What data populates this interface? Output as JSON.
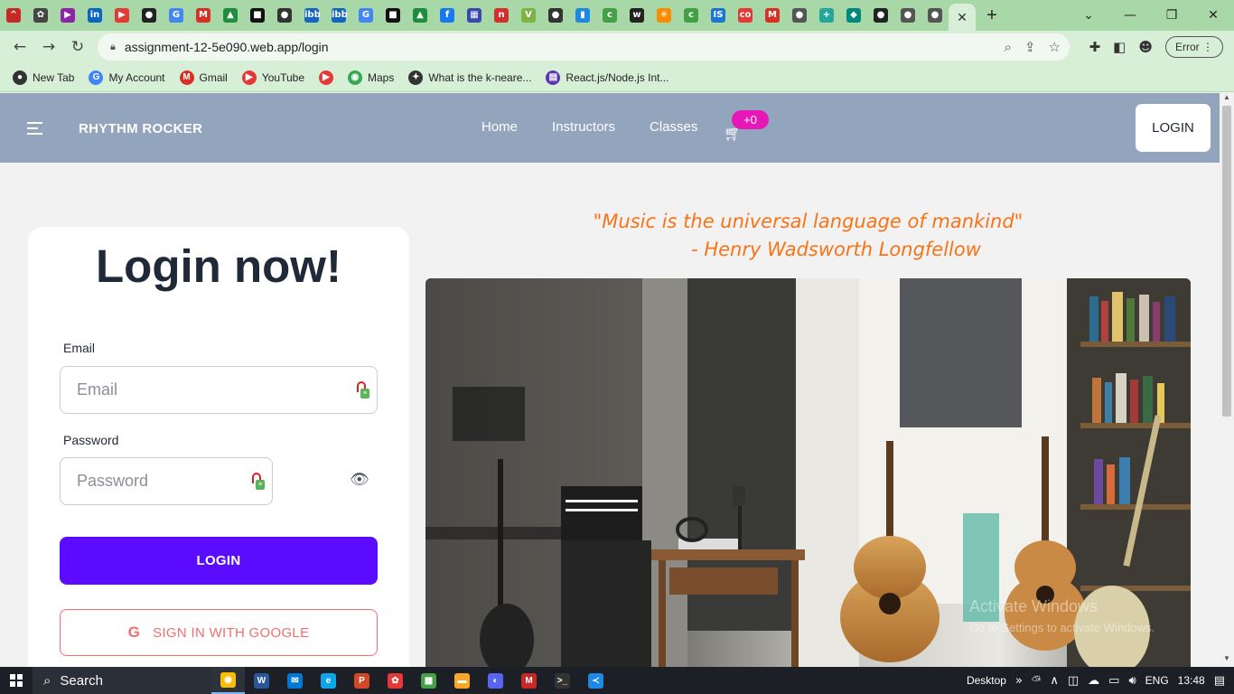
{
  "browser": {
    "tab_favicons": [
      {
        "name": "tab-favicon-1",
        "color": "#c62828",
        "glyph": "^"
      },
      {
        "name": "tab-favicon-chatgpt",
        "color": "#444444",
        "glyph": "✿"
      },
      {
        "name": "tab-favicon-3",
        "color": "#8e24aa",
        "glyph": "▶"
      },
      {
        "name": "tab-favicon-linkedin",
        "color": "#0a66c2",
        "glyph": "in"
      },
      {
        "name": "tab-favicon-youtube",
        "color": "#e53935",
        "glyph": "▶"
      },
      {
        "name": "tab-favicon-github",
        "color": "#222222",
        "glyph": "●"
      },
      {
        "name": "tab-favicon-google",
        "color": "#4285f4",
        "glyph": "G"
      },
      {
        "name": "tab-favicon-gmail",
        "color": "#d93025",
        "glyph": "M"
      },
      {
        "name": "tab-favicon-drive",
        "color": "#1e8e3e",
        "glyph": "▲"
      },
      {
        "name": "tab-favicon-10",
        "color": "#111111",
        "glyph": "■"
      },
      {
        "name": "tab-favicon-11",
        "color": "#333333",
        "glyph": "●"
      },
      {
        "name": "tab-favicon-imgbb-1",
        "color": "#1565c0",
        "glyph": "ibb"
      },
      {
        "name": "tab-favicon-imgbb-2",
        "color": "#1565c0",
        "glyph": "ibb"
      },
      {
        "name": "tab-favicon-google-2",
        "color": "#4285f4",
        "glyph": "G"
      },
      {
        "name": "tab-favicon-15",
        "color": "#111111",
        "glyph": "■"
      },
      {
        "name": "tab-favicon-drive-2",
        "color": "#1e8e3e",
        "glyph": "▲"
      },
      {
        "name": "tab-favicon-facebook",
        "color": "#1877f2",
        "glyph": "f"
      },
      {
        "name": "tab-favicon-18",
        "color": "#3949ab",
        "glyph": "▦"
      },
      {
        "name": "tab-favicon-19",
        "color": "#d32f2f",
        "glyph": "n"
      },
      {
        "name": "tab-favicon-20",
        "color": "#7cb342",
        "glyph": "V"
      },
      {
        "name": "tab-favicon-21",
        "color": "#333333",
        "glyph": "●"
      },
      {
        "name": "tab-favicon-22",
        "color": "#1e88e5",
        "glyph": "▮"
      },
      {
        "name": "tab-favicon-23",
        "color": "#43a047",
        "glyph": "c"
      },
      {
        "name": "tab-favicon-w3",
        "color": "#222222",
        "glyph": "w"
      },
      {
        "name": "tab-favicon-25",
        "color": "#fb8c00",
        "glyph": "✳"
      },
      {
        "name": "tab-favicon-26",
        "color": "#43a047",
        "glyph": "c"
      },
      {
        "name": "tab-favicon-27",
        "color": "#1976d2",
        "glyph": "IS"
      },
      {
        "name": "tab-favicon-28",
        "color": "#e53935",
        "glyph": "co"
      },
      {
        "name": "tab-favicon-gmail-2",
        "color": "#d93025",
        "glyph": "M"
      },
      {
        "name": "tab-favicon-30",
        "color": "#555555",
        "glyph": "●"
      },
      {
        "name": "tab-favicon-31",
        "color": "#26a69a",
        "glyph": "+"
      },
      {
        "name": "tab-favicon-32",
        "color": "#00897b",
        "glyph": "◆"
      },
      {
        "name": "tab-favicon-github-2",
        "color": "#222222",
        "glyph": "●"
      },
      {
        "name": "tab-favicon-34",
        "color": "#555555",
        "glyph": "●"
      },
      {
        "name": "tab-favicon-35",
        "color": "#555555",
        "glyph": "●"
      }
    ],
    "active_tab_close": "✕",
    "new_tab": "+",
    "url": "assignment-12-5e090.web.app/login",
    "error_pill": "Error",
    "bookmarks": [
      {
        "name": "bookmark-new-tab",
        "label": "New Tab",
        "color": "#333333",
        "glyph": "●"
      },
      {
        "name": "bookmark-my-account",
        "label": "My Account",
        "color": "#4285f4",
        "glyph": "G"
      },
      {
        "name": "bookmark-gmail",
        "label": "Gmail",
        "color": "#d93025",
        "glyph": "M"
      },
      {
        "name": "bookmark-youtube",
        "label": "YouTube",
        "color": "#e53935",
        "glyph": "▶"
      },
      {
        "name": "bookmark-youtube-2",
        "label": "",
        "color": "#e53935",
        "glyph": "▶"
      },
      {
        "name": "bookmark-maps",
        "label": "Maps",
        "color": "#34a853",
        "glyph": "◉"
      },
      {
        "name": "bookmark-knn",
        "label": "What is the k-neare...",
        "color": "#333333",
        "glyph": "✦"
      },
      {
        "name": "bookmark-react",
        "label": "React.js/Node.js Int...",
        "color": "#5e35b1",
        "glyph": "▤"
      }
    ]
  },
  "site": {
    "brand": "RHYTHM ROCKER",
    "nav": [
      "Home",
      "Instructors",
      "Classes"
    ],
    "cart_count": "+0",
    "login_button": "LOGIN"
  },
  "login_form": {
    "title": "Login now!",
    "email_label": "Email",
    "email_placeholder": "Email",
    "password_label": "Password",
    "password_placeholder": "Password",
    "submit": "LOGIN",
    "google_icon": "G",
    "google_button": "SIGN IN WITH GOOGLE"
  },
  "quote": {
    "text": "\"Music is the universal language of mankind\"",
    "author": "- Henry Wadsworth Longfellow"
  },
  "watermark": {
    "line1": "Activate Windows",
    "line2": "Go to Settings to activate Windows."
  },
  "taskbar": {
    "search": "Search",
    "apps": [
      {
        "name": "taskbar-chrome",
        "color": "#fbbc04",
        "glyph": "◉",
        "active": true
      },
      {
        "name": "taskbar-word",
        "color": "#2b579a",
        "glyph": "W"
      },
      {
        "name": "taskbar-mail",
        "color": "#0078d4",
        "glyph": "✉"
      },
      {
        "name": "taskbar-edge",
        "color": "#0ea5e9",
        "glyph": "e"
      },
      {
        "name": "taskbar-powerpoint",
        "color": "#d24726",
        "glyph": "P"
      },
      {
        "name": "taskbar-app-6",
        "color": "#e53935",
        "glyph": "✿"
      },
      {
        "name": "taskbar-app-7",
        "color": "#43a047",
        "glyph": "▦"
      },
      {
        "name": "taskbar-explorer",
        "color": "#f9a825",
        "glyph": "▬"
      },
      {
        "name": "taskbar-discord",
        "color": "#5865f2",
        "glyph": "◐"
      },
      {
        "name": "taskbar-mcafee",
        "color": "#c62828",
        "glyph": "M"
      },
      {
        "name": "taskbar-terminal",
        "color": "#333333",
        "glyph": ">_"
      },
      {
        "name": "taskbar-vscode",
        "color": "#1e88e5",
        "glyph": "≺"
      }
    ],
    "desktop": "Desktop",
    "lang": "ENG",
    "time": "13:48"
  }
}
